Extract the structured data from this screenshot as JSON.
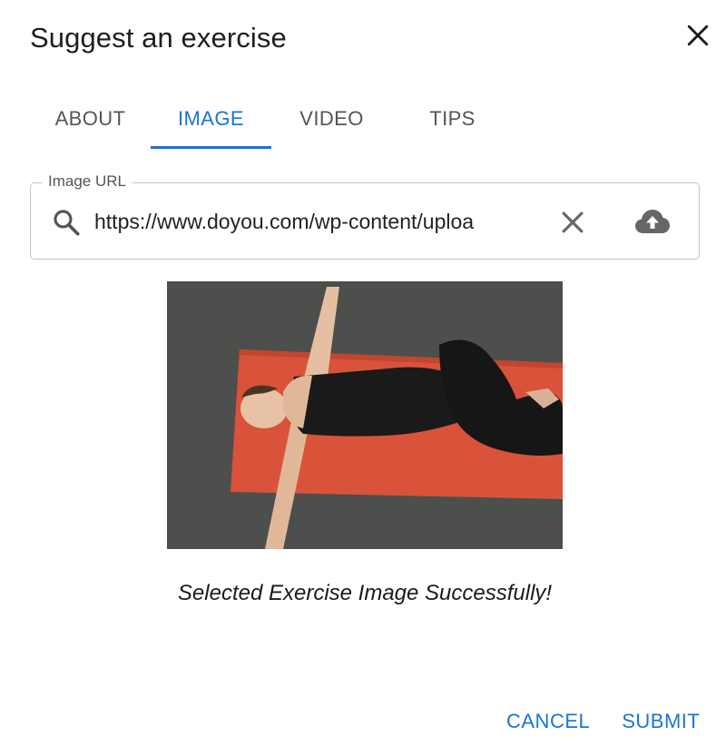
{
  "dialog": {
    "title": "Suggest an exercise",
    "close_icon": "close-icon"
  },
  "tabs": [
    {
      "label": "ABOUT",
      "active": false
    },
    {
      "label": "IMAGE",
      "active": true
    },
    {
      "label": "VIDEO",
      "active": false
    },
    {
      "label": "TIPS",
      "active": false
    }
  ],
  "image_url_field": {
    "label": "Image URL",
    "value": "https://www.doyou.com/wp-content/uploa",
    "leading_icon": "search-icon",
    "clear_icon": "clear-icon",
    "upload_icon": "cloud-upload-icon"
  },
  "preview": {
    "description_icon": "exercise-photo"
  },
  "status_message": "Selected Exercise Image Successfully!",
  "actions": {
    "cancel_label": "CANCEL",
    "submit_label": "SUBMIT"
  },
  "colors": {
    "accent": "#1976d2",
    "text": "#1f1f1f",
    "muted": "#555555",
    "border": "#c4c4c4"
  }
}
